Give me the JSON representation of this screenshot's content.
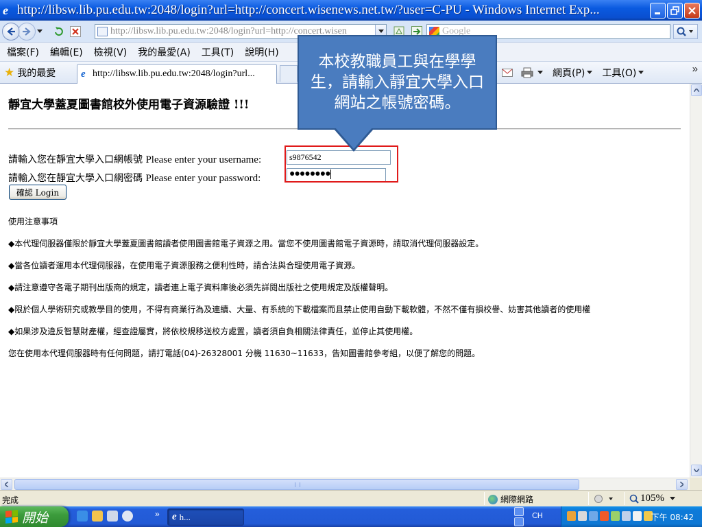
{
  "window": {
    "title": "http://libsw.lib.pu.edu.tw:2048/login?url=http://concert.wisenews.net.tw/?user=C-PU - Windows Internet Exp...",
    "minimize_icon": "minimize-icon",
    "maximize_icon": "restore-icon",
    "close_icon": "close-icon"
  },
  "address_bar": {
    "url": "http://libsw.lib.pu.edu.tw:2048/login?url=http://concert.wisen",
    "search_placeholder": "Google"
  },
  "menu": {
    "items": [
      "檔案(F)",
      "編輯(E)",
      "檢視(V)",
      "我的最愛(A)",
      "工具(T)",
      "說明(H)"
    ]
  },
  "favorites_bar": {
    "favorites_label": "我的最愛",
    "tab_title": "http://libsw.lib.pu.edu.tw:2048/login?url...",
    "page_menu": "網頁(P)",
    "tools_menu": "工具(O)"
  },
  "page": {
    "heading": "靜宜大學蓋夏圖書館校外使用電子資源驗證 !!!",
    "username_label_zh": "請輸入您在靜宜大學入口網帳號",
    "username_label_en": "Please enter your username:",
    "username_value": "s9876542",
    "password_label_zh": "請輸入您在靜宜大學入口網密碼",
    "password_label_en": "Please enter your password:",
    "password_value": "●●●●●●●●",
    "login_button": "確認 Login",
    "notes_title": "使用注意事項",
    "notes": [
      "◆本代理伺服器僅限於靜宜大學蓋夏圖書館讀者使用圖書館電子資源之用。當您不使用圖書館電子資源時，請取消代理伺服器設定。",
      "◆當各位讀者運用本代理伺服器，在使用電子資源服務之便利性時，請合法與合理使用電子資源。",
      "◆請注意遵守各電子期刊出版商的規定，讀者連上電子資料庫後必須先詳閱出版社之使用規定及版權聲明。",
      "◆限於個人學術研究或教學目的使用，不得有商業行為及連續、大量、有系統的下載檔案而且禁止使用自動下載軟體，不然不僅有損校譽、妨害其他讀者的使用權",
      "◆如果涉及違反智慧財產權，經查證屬實，將依校規移送校方處置，讀者須自負相關法律責任，並停止其使用權。",
      "您在使用本代理伺服器時有任何問題，請打電話(04)-26328001 分機  11630~11633，告知圖書館參考組，以便了解您的問題。"
    ]
  },
  "callout": {
    "text": "本校教職員工與在學學生，請輸入靜宜大學入口網站之帳號密碼。"
  },
  "status_bar": {
    "status": "完成",
    "zone": "網際網路",
    "zoom": "105%"
  },
  "taskbar": {
    "start_label": "開始",
    "task_label": "h...",
    "lang": "CH",
    "clock": "下午 08:42"
  }
}
